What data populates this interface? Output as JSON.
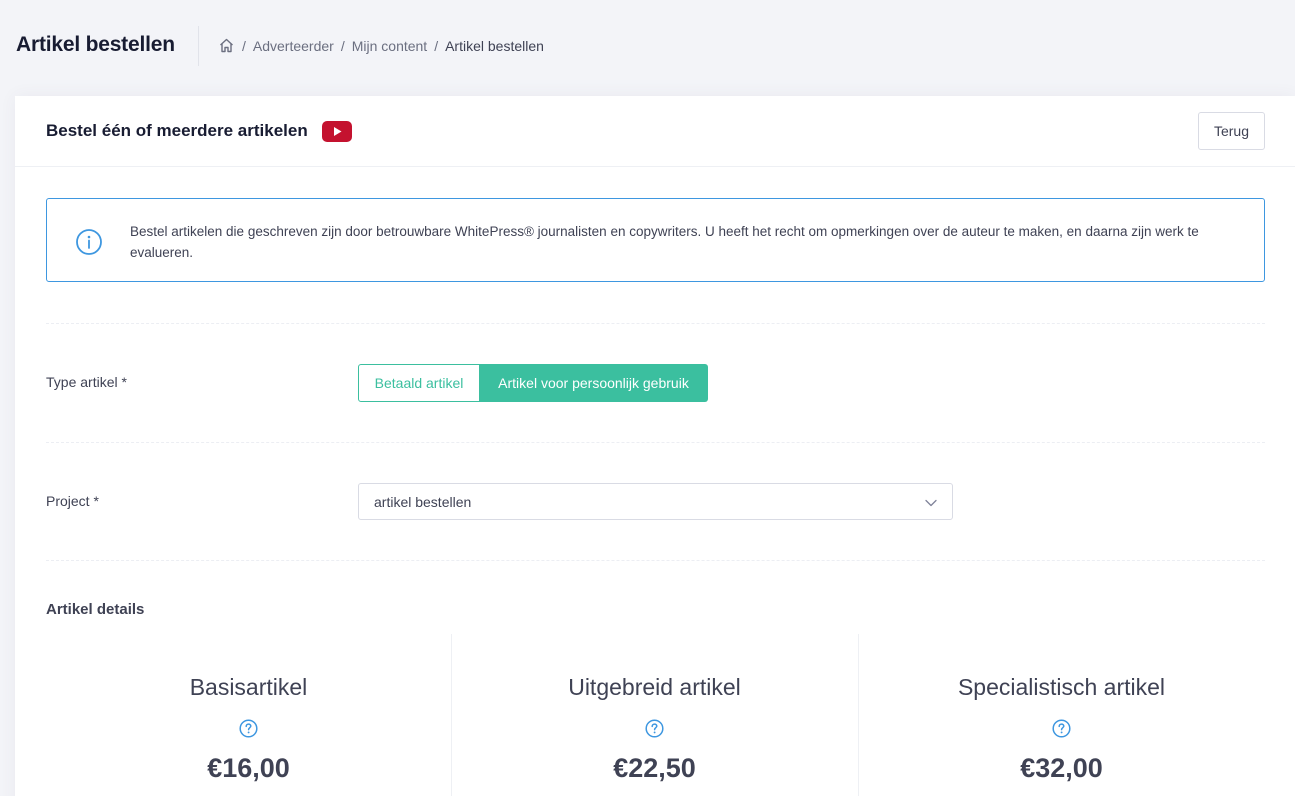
{
  "header": {
    "title": "Artikel bestellen",
    "breadcrumb": {
      "home_icon": "home-icon",
      "items": [
        "Adverteerder",
        "Mijn content",
        "Artikel bestellen"
      ]
    }
  },
  "card": {
    "title": "Bestel één of meerdere artikelen",
    "video_icon": "youtube-icon",
    "back_label": "Terug"
  },
  "info": {
    "icon": "info-icon",
    "text": "Bestel artikelen die geschreven zijn door betrouwbare WhitePress® journalisten en copywriters. U heeft het recht om opmerkingen over de auteur te maken, en daarna zijn werk te evalueren."
  },
  "form": {
    "type_label": "Type artikel *",
    "type_options": [
      "Betaald artikel",
      "Artikel voor persoonlijk gebruik"
    ],
    "type_selected": "Artikel voor persoonlijk gebruik",
    "project_label": "Project *",
    "project_value": "artikel bestellen"
  },
  "details": {
    "title": "Artikel details",
    "plans": [
      {
        "name": "Basisartikel",
        "price": "€16,00"
      },
      {
        "name": "Uitgebreid artikel",
        "price": "€22,50"
      },
      {
        "name": "Specialistisch artikel",
        "price": "€32,00"
      }
    ]
  },
  "colors": {
    "accent": "#3bbf9f",
    "info_border": "#3e97e0",
    "youtube": "#c4122f"
  }
}
